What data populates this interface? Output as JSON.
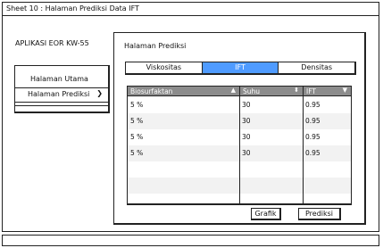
{
  "window": {
    "title": "Sheet 10 : Halaman Prediksi Data IFT"
  },
  "app": {
    "name": "APLIKASI EOR KW-55"
  },
  "sidebar": {
    "items": [
      {
        "label": "Halaman Utama"
      },
      {
        "label": "Halaman Prediksi",
        "chevron": "chevron-right-icon"
      }
    ]
  },
  "panel": {
    "title": "Halaman Prediksi",
    "tabs": [
      {
        "label": "Viskositas",
        "active": false
      },
      {
        "label": "IFT",
        "active": true
      },
      {
        "label": "Densitas",
        "active": false
      }
    ],
    "table": {
      "columns": [
        {
          "label": "Biosurfaktan",
          "sort_icon": "sort-asc-icon"
        },
        {
          "label": "Suhu",
          "sort_icon": "sort-both-icon"
        },
        {
          "label": "IFT",
          "sort_icon": "sort-desc-icon"
        }
      ],
      "rows": [
        [
          "5 %",
          "30",
          "0.95"
        ],
        [
          "5 %",
          "30",
          "0.95"
        ],
        [
          "5 %",
          "30",
          "0.95"
        ],
        [
          "5 %",
          "30",
          "0.95"
        ]
      ]
    },
    "buttons": {
      "chart_label": "Grafik",
      "predict_label": "Prediksi"
    }
  },
  "colors": {
    "active_tab": "#4f9bff",
    "table_header": "#8c8c8c",
    "alt_row": "#f2f2f2"
  }
}
